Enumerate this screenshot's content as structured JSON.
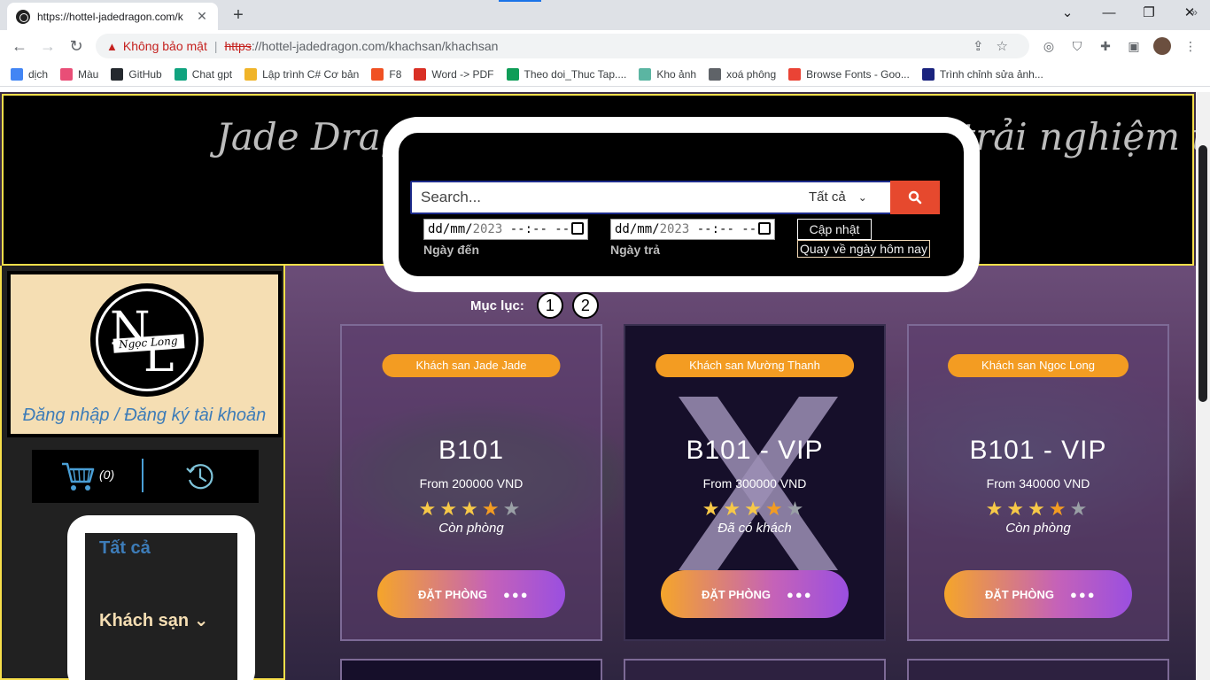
{
  "browser": {
    "tab_title": "https://hottel-jadedragon.com/k",
    "tab_close": "✕",
    "new_tab": "+",
    "window_controls": [
      "⌄",
      "—",
      "❐",
      "✕"
    ],
    "security_warning": "Không bảo mật",
    "url_scheme": "https",
    "url_rest": "://hottel-jadedragon.com/khachsan/khachsan",
    "bookmarks": [
      {
        "label": "dịch",
        "color": "#4285f4"
      },
      {
        "label": "Màu",
        "color": "#e94e77"
      },
      {
        "label": "GitHub",
        "color": "#24292e"
      },
      {
        "label": "Chat gpt",
        "color": "#10a37f"
      },
      {
        "label": "Lập trình C# Cơ bản",
        "color": "#f0b429"
      },
      {
        "label": "F8",
        "color": "#f05123"
      },
      {
        "label": "Word -> PDF",
        "color": "#d93025"
      },
      {
        "label": "Theo doi_Thuc Tap....",
        "color": "#0f9d58"
      },
      {
        "label": "Kho ảnh",
        "color": "#5bb5a2"
      },
      {
        "label": "xoá phông",
        "color": "#5f6368"
      },
      {
        "label": "Browse Fonts - Goo...",
        "color": "#ea4335"
      },
      {
        "label": "Trình chỉnh sửa ảnh...",
        "color": "#1a237e"
      }
    ],
    "bookmarks_more": "»"
  },
  "header": {
    "slogan": "Jade Dragon sẽ mang đến cho bạn một trải nghiệm tuyệt vời",
    "search": {
      "placeholder": "Search...",
      "category": "Tất cả",
      "date_from_value": "dd/mm/",
      "date_from_year": "2023",
      "date_from_time": " --:-- --",
      "date_from_label": "Ngày đến",
      "date_to_value": "dd/mm/",
      "date_to_year": "2023",
      "date_to_time": " --:-- --",
      "date_to_label": "Ngày trả",
      "update_label": "Cập nhật",
      "today_label": "Quay về ngày hôm nay"
    }
  },
  "sidebar": {
    "logo_letters_1": "N",
    "logo_letters_2": "L",
    "logo_name": "Ngọc Long",
    "login_text": "Đăng nhập / Đăng ký tài khoản",
    "cart_count": "(0)",
    "menu_all": "Tất cả",
    "menu_hotel": "Khách sạn ⌄"
  },
  "content": {
    "pager_label": "Mục lục:",
    "pages": [
      "1",
      "2"
    ],
    "book_label": "ĐẶT PHÒNG",
    "book_dots": "●●●",
    "cards": [
      {
        "hotel": "Khách san Jade Jade",
        "room": "B101",
        "price": "From 200000 VND",
        "rating": 4,
        "status": "Còn phòng",
        "booked": false
      },
      {
        "hotel": "Khách san Mường Thanh",
        "room": "B101 - VIP",
        "price": "From 300000 VND",
        "rating": 4,
        "status": "Đã có khách",
        "booked": true
      },
      {
        "hotel": "Khách san Ngoc Long",
        "room": "B101 - VIP",
        "price": "From 340000 VND",
        "rating": 4,
        "status": "Còn phòng",
        "booked": false
      }
    ]
  },
  "colors": {
    "header_border": "#f7df4a",
    "search_button": "#e6492e",
    "tag_orange": "#f39c22",
    "link_blue": "#3d7cb8",
    "account_bg": "#f5deb3"
  }
}
